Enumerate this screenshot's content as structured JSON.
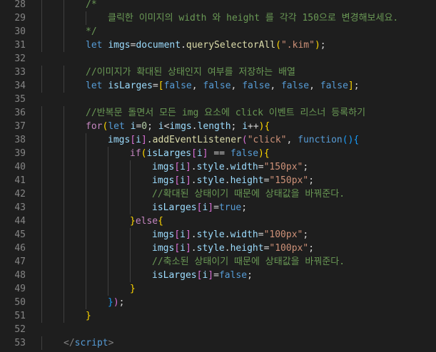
{
  "editor": {
    "colors": {
      "background": "#1e1e1e",
      "line_number": "#858585",
      "keyword": "#569cd6",
      "control": "#c586c0",
      "variable": "#9cdcfe",
      "function": "#dcdcaa",
      "string": "#ce9178",
      "number": "#b5cea8",
      "comment": "#6a9955"
    },
    "lines": [
      {
        "n": "28",
        "indent": 2,
        "tokens": [
          {
            "t": "/*",
            "c": "com"
          }
        ]
      },
      {
        "n": "29",
        "indent": 3,
        "tokens": [
          {
            "t": "클릭한 이미지의 width 와 height 를 각각 150으로 변경해보세요.",
            "c": "com"
          }
        ]
      },
      {
        "n": "30",
        "indent": 2,
        "tokens": [
          {
            "t": "*/",
            "c": "com"
          }
        ]
      },
      {
        "n": "31",
        "indent": 2,
        "tokens": [
          {
            "t": "let",
            "c": "kw"
          },
          {
            "t": " ",
            "c": "pun"
          },
          {
            "t": "imgs",
            "c": "var"
          },
          {
            "t": "=",
            "c": "pun"
          },
          {
            "t": "document",
            "c": "var"
          },
          {
            "t": ".",
            "c": "pun"
          },
          {
            "t": "querySelectorAll",
            "c": "fn"
          },
          {
            "t": "(",
            "c": "br1"
          },
          {
            "t": "\".kim\"",
            "c": "str"
          },
          {
            "t": ")",
            "c": "br1"
          },
          {
            "t": ";",
            "c": "pun"
          }
        ]
      },
      {
        "n": "32",
        "indent": 0,
        "tokens": []
      },
      {
        "n": "33",
        "indent": 2,
        "tokens": [
          {
            "t": "//이미지가 확대된 상태인지 여부를 저장하는 배열",
            "c": "com"
          }
        ]
      },
      {
        "n": "34",
        "indent": 2,
        "tokens": [
          {
            "t": "let",
            "c": "kw"
          },
          {
            "t": " ",
            "c": "pun"
          },
          {
            "t": "isLarges",
            "c": "var"
          },
          {
            "t": "=",
            "c": "pun"
          },
          {
            "t": "[",
            "c": "br1"
          },
          {
            "t": "false",
            "c": "kw"
          },
          {
            "t": ", ",
            "c": "pun"
          },
          {
            "t": "false",
            "c": "kw"
          },
          {
            "t": ", ",
            "c": "pun"
          },
          {
            "t": "false",
            "c": "kw"
          },
          {
            "t": ", ",
            "c": "pun"
          },
          {
            "t": "false",
            "c": "kw"
          },
          {
            "t": ", ",
            "c": "pun"
          },
          {
            "t": "false",
            "c": "kw"
          },
          {
            "t": "]",
            "c": "br1"
          },
          {
            "t": ";",
            "c": "pun"
          }
        ]
      },
      {
        "n": "35",
        "indent": 0,
        "tokens": []
      },
      {
        "n": "36",
        "indent": 2,
        "tokens": [
          {
            "t": "//반복문 돌면서 모든 img 요소에 click 이벤트 리스너 등록하기",
            "c": "com"
          }
        ]
      },
      {
        "n": "37",
        "indent": 2,
        "tokens": [
          {
            "t": "for",
            "c": "ctrl"
          },
          {
            "t": "(",
            "c": "br1"
          },
          {
            "t": "let",
            "c": "kw"
          },
          {
            "t": " ",
            "c": "pun"
          },
          {
            "t": "i",
            "c": "var"
          },
          {
            "t": "=",
            "c": "pun"
          },
          {
            "t": "0",
            "c": "num"
          },
          {
            "t": "; ",
            "c": "pun"
          },
          {
            "t": "i",
            "c": "var"
          },
          {
            "t": "<",
            "c": "pun"
          },
          {
            "t": "imgs",
            "c": "var"
          },
          {
            "t": ".",
            "c": "pun"
          },
          {
            "t": "length",
            "c": "var"
          },
          {
            "t": "; ",
            "c": "pun"
          },
          {
            "t": "i",
            "c": "var"
          },
          {
            "t": "++",
            "c": "pun"
          },
          {
            "t": ")",
            "c": "br1"
          },
          {
            "t": "{",
            "c": "br1"
          }
        ]
      },
      {
        "n": "38",
        "indent": 3,
        "tokens": [
          {
            "t": "imgs",
            "c": "var"
          },
          {
            "t": "[",
            "c": "br2"
          },
          {
            "t": "i",
            "c": "var"
          },
          {
            "t": "]",
            "c": "br2"
          },
          {
            "t": ".",
            "c": "pun"
          },
          {
            "t": "addEventListener",
            "c": "fn"
          },
          {
            "t": "(",
            "c": "br2"
          },
          {
            "t": "\"click\"",
            "c": "str"
          },
          {
            "t": ", ",
            "c": "pun"
          },
          {
            "t": "function",
            "c": "kw"
          },
          {
            "t": "(",
            "c": "br3"
          },
          {
            "t": ")",
            "c": "br3"
          },
          {
            "t": "{",
            "c": "br3"
          }
        ]
      },
      {
        "n": "39",
        "indent": 4,
        "tokens": [
          {
            "t": "if",
            "c": "ctrl"
          },
          {
            "t": "(",
            "c": "br1"
          },
          {
            "t": "isLarges",
            "c": "var"
          },
          {
            "t": "[",
            "c": "br2"
          },
          {
            "t": "i",
            "c": "var"
          },
          {
            "t": "]",
            "c": "br2"
          },
          {
            "t": " == ",
            "c": "pun"
          },
          {
            "t": "false",
            "c": "kw"
          },
          {
            "t": ")",
            "c": "br1"
          },
          {
            "t": "{",
            "c": "br1"
          }
        ]
      },
      {
        "n": "40",
        "indent": 5,
        "tokens": [
          {
            "t": "imgs",
            "c": "var"
          },
          {
            "t": "[",
            "c": "br2"
          },
          {
            "t": "i",
            "c": "var"
          },
          {
            "t": "]",
            "c": "br2"
          },
          {
            "t": ".",
            "c": "pun"
          },
          {
            "t": "style",
            "c": "var"
          },
          {
            "t": ".",
            "c": "pun"
          },
          {
            "t": "width",
            "c": "var"
          },
          {
            "t": "=",
            "c": "pun"
          },
          {
            "t": "\"150px\"",
            "c": "str"
          },
          {
            "t": ";",
            "c": "pun"
          }
        ]
      },
      {
        "n": "41",
        "indent": 5,
        "tokens": [
          {
            "t": "imgs",
            "c": "var"
          },
          {
            "t": "[",
            "c": "br2"
          },
          {
            "t": "i",
            "c": "var"
          },
          {
            "t": "]",
            "c": "br2"
          },
          {
            "t": ".",
            "c": "pun"
          },
          {
            "t": "style",
            "c": "var"
          },
          {
            "t": ".",
            "c": "pun"
          },
          {
            "t": "height",
            "c": "var"
          },
          {
            "t": "=",
            "c": "pun"
          },
          {
            "t": "\"150px\"",
            "c": "str"
          },
          {
            "t": ";",
            "c": "pun"
          }
        ]
      },
      {
        "n": "42",
        "indent": 5,
        "tokens": [
          {
            "t": "//확대된 상태이기 때문에 상태값을 바꿔준다.",
            "c": "com"
          }
        ]
      },
      {
        "n": "43",
        "indent": 5,
        "tokens": [
          {
            "t": "isLarges",
            "c": "var"
          },
          {
            "t": "[",
            "c": "br2"
          },
          {
            "t": "i",
            "c": "var"
          },
          {
            "t": "]",
            "c": "br2"
          },
          {
            "t": "=",
            "c": "pun"
          },
          {
            "t": "true",
            "c": "kw"
          },
          {
            "t": ";",
            "c": "pun"
          }
        ]
      },
      {
        "n": "44",
        "indent": 4,
        "tokens": [
          {
            "t": "}",
            "c": "br1"
          },
          {
            "t": "else",
            "c": "ctrl"
          },
          {
            "t": "{",
            "c": "br1"
          }
        ]
      },
      {
        "n": "45",
        "indent": 5,
        "tokens": [
          {
            "t": "imgs",
            "c": "var"
          },
          {
            "t": "[",
            "c": "br2"
          },
          {
            "t": "i",
            "c": "var"
          },
          {
            "t": "]",
            "c": "br2"
          },
          {
            "t": ".",
            "c": "pun"
          },
          {
            "t": "style",
            "c": "var"
          },
          {
            "t": ".",
            "c": "pun"
          },
          {
            "t": "width",
            "c": "var"
          },
          {
            "t": "=",
            "c": "pun"
          },
          {
            "t": "\"100px\"",
            "c": "str"
          },
          {
            "t": ";",
            "c": "pun"
          }
        ]
      },
      {
        "n": "46",
        "indent": 5,
        "tokens": [
          {
            "t": "imgs",
            "c": "var"
          },
          {
            "t": "[",
            "c": "br2"
          },
          {
            "t": "i",
            "c": "var"
          },
          {
            "t": "]",
            "c": "br2"
          },
          {
            "t": ".",
            "c": "pun"
          },
          {
            "t": "style",
            "c": "var"
          },
          {
            "t": ".",
            "c": "pun"
          },
          {
            "t": "height",
            "c": "var"
          },
          {
            "t": "=",
            "c": "pun"
          },
          {
            "t": "\"100px\"",
            "c": "str"
          },
          {
            "t": ";",
            "c": "pun"
          }
        ]
      },
      {
        "n": "47",
        "indent": 5,
        "tokens": [
          {
            "t": "//축소된 상태이기 때문에 상태값을 바꿔준다.",
            "c": "com"
          }
        ]
      },
      {
        "n": "48",
        "indent": 5,
        "tokens": [
          {
            "t": "isLarges",
            "c": "var"
          },
          {
            "t": "[",
            "c": "br2"
          },
          {
            "t": "i",
            "c": "var"
          },
          {
            "t": "]",
            "c": "br2"
          },
          {
            "t": "=",
            "c": "pun"
          },
          {
            "t": "false",
            "c": "kw"
          },
          {
            "t": ";",
            "c": "pun"
          }
        ]
      },
      {
        "n": "49",
        "indent": 4,
        "tokens": [
          {
            "t": "}",
            "c": "br1"
          }
        ]
      },
      {
        "n": "50",
        "indent": 3,
        "tokens": [
          {
            "t": "}",
            "c": "br3"
          },
          {
            "t": ")",
            "c": "br2"
          },
          {
            "t": ";",
            "c": "pun"
          }
        ]
      },
      {
        "n": "51",
        "indent": 2,
        "tokens": [
          {
            "t": "}",
            "c": "br1"
          }
        ]
      },
      {
        "n": "52",
        "indent": 0,
        "tokens": []
      },
      {
        "n": "53",
        "indent": 1,
        "tokens": [
          {
            "t": "</",
            "c": "tag"
          },
          {
            "t": "script",
            "c": "tagname"
          },
          {
            "t": ">",
            "c": "tag"
          }
        ]
      }
    ]
  }
}
